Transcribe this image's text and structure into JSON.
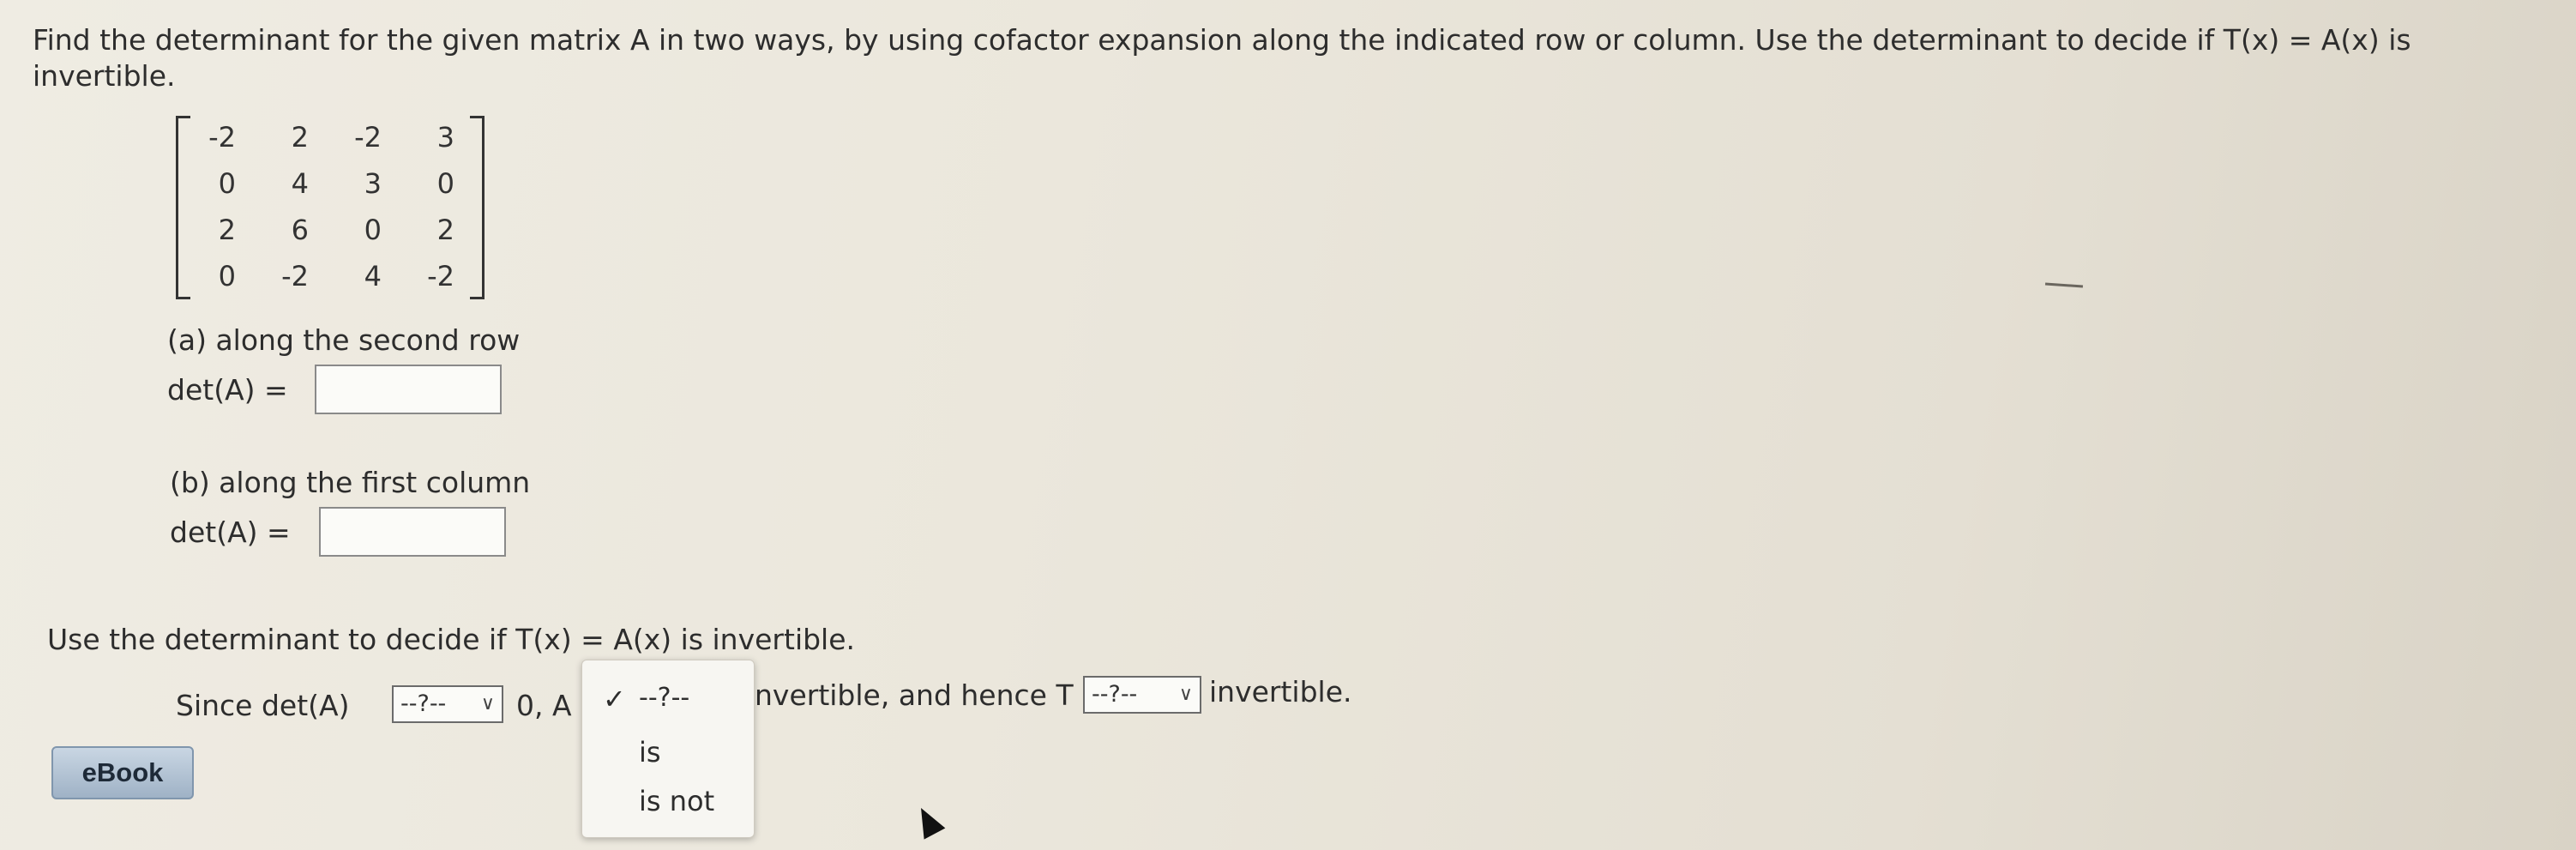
{
  "question": {
    "line1": "Find the determinant for the given matrix A in two ways, by using cofactor expansion along the indicated row or column. Use the determinant to decide if T(x) = A(x) is",
    "line2": "invertible."
  },
  "matrix": [
    [
      "-2",
      "2",
      "-2",
      "3"
    ],
    [
      "0",
      "4",
      "3",
      "0"
    ],
    [
      "2",
      "6",
      "0",
      "2"
    ],
    [
      "0",
      "-2",
      "4",
      "-2"
    ]
  ],
  "part_a": {
    "label": "(a) along the second row",
    "det_label": "det(A) =",
    "value": ""
  },
  "part_b": {
    "label": "(b) along the first column",
    "det_label": "det(A) =",
    "value": ""
  },
  "decide": {
    "text": "Use the determinant to decide if T(x) = A(x) is invertible.",
    "since": "Since det(A)",
    "after_sel1": "0, A",
    "after_dd": "nvertible, and hence T",
    "end": "invertible."
  },
  "selects": {
    "sel1": "--?--",
    "sel3": "--?--"
  },
  "dropdown": {
    "selected": "--?--",
    "check": "✓",
    "options": [
      "is",
      "is not"
    ]
  },
  "ebook_label": "eBook"
}
